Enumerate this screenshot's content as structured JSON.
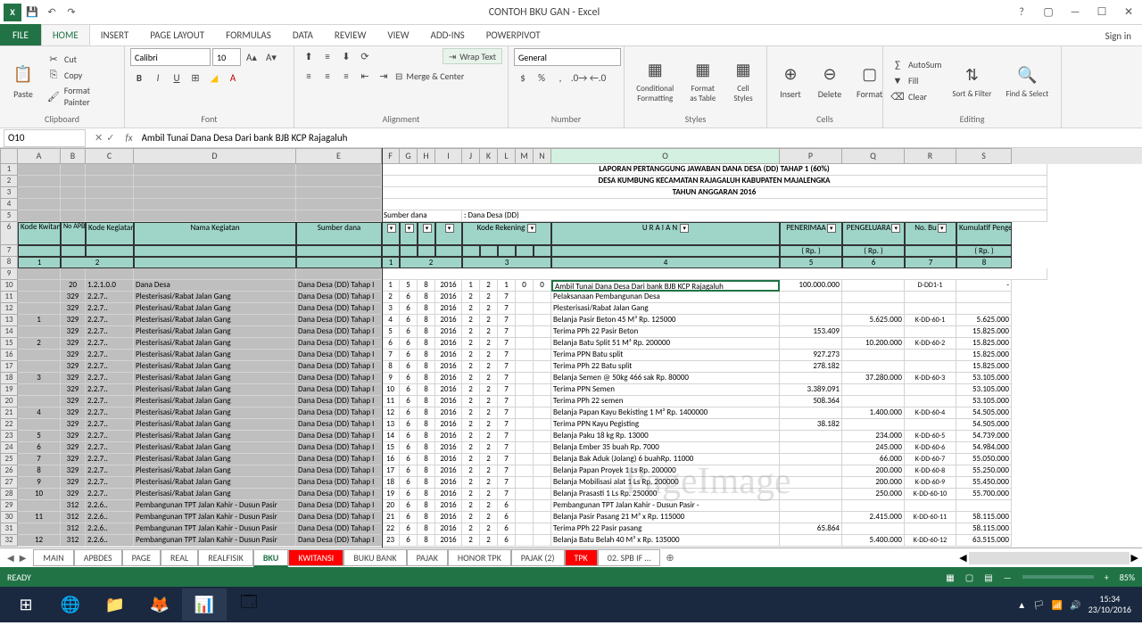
{
  "app": {
    "title": "CONTOH BKU GAN - Excel"
  },
  "ribbon_tabs": {
    "file": "FILE",
    "home": "HOME",
    "insert": "INSERT",
    "pagelayout": "PAGE LAYOUT",
    "formulas": "FORMULAS",
    "data": "DATA",
    "review": "REVIEW",
    "view": "VIEW",
    "addins": "ADD-INS",
    "powerpivot": "POWERPIVOT",
    "signin": "Sign in"
  },
  "clipboard": {
    "paste": "Paste",
    "cut": "Cut",
    "copy": "Copy",
    "fp": "Format Painter",
    "label": "Clipboard"
  },
  "font": {
    "name": "Calibri",
    "size": "10",
    "label": "Font"
  },
  "align": {
    "wt": "Wrap Text",
    "mc": "Merge & Center",
    "label": "Alignment"
  },
  "number": {
    "fmt": "General",
    "label": "Number"
  },
  "styles": {
    "cf": "Conditional Formatting",
    "fat": "Format as Table",
    "cs": "Cell Styles",
    "label": "Styles"
  },
  "cells": {
    "ins": "Insert",
    "del": "Delete",
    "fmt": "Format",
    "label": "Cells"
  },
  "editing": {
    "as": "AutoSum",
    "fill": "Fill",
    "clr": "Clear",
    "sf": "Sort & Filter",
    "fs": "Find & Select",
    "label": "Editing"
  },
  "namebox": "O10",
  "formula": "Ambil Tunai Dana Desa Dari bank BJB KCP Rajagaluh",
  "cols": [
    "A",
    "B",
    "C",
    "D",
    "E",
    "F",
    "G",
    "H",
    "I",
    "J",
    "K",
    "L",
    "M",
    "N",
    "O",
    "P",
    "Q",
    "R",
    "S"
  ],
  "rpt": {
    "t1": "LAPORAN PERTANGGUNG JAWABAN DANA DESA (DD) TAHAP 1 (60%)",
    "t2": "DESA KUMBUNG KECAMATAN RAJAGALUH KABUPATEN MAJALENGKA",
    "t3": "TAHUN ANGGARAN 2016",
    "sd_l": "Sumber dana",
    "sd_v": ": Dana Desa (DD)"
  },
  "hdr": {
    "kk": "Kode Kwitansi",
    "noap": "No APBD ES",
    "kkeg": "Kode Kegiatan",
    "nk": "Nama Kegiatan",
    "sd": "Sumber dana",
    "kr": "Kode Rekening",
    "ur": "U R A I A N",
    "pen": "PENERIMAA",
    "peng": "PENGELUARA",
    "nb": "No. Bu",
    "kp": "Kumulatif Pengeluaran",
    "rp": "( Rp. )",
    "n1": "1",
    "n2": "2",
    "n3": "3",
    "n4": "4",
    "n5": "5",
    "n6": "6",
    "n7": "7",
    "n8": "8"
  },
  "rows": [
    {
      "r": 10,
      "kk": "",
      "no": "20",
      "kkeg": "1.2.1.0.0",
      "nk": "Dana Desa",
      "sd": "Dana Desa (DD) Tahap I",
      "f": "1",
      "g": "5",
      "h": "8",
      "i": "2016",
      "j": "1",
      "k": "2",
      "l": "1",
      "m": "0",
      "n": "0",
      "ur": "Ambil Tunai Dana Desa Dari bank BJB KCP Rajagaluh",
      "pen": "100.000.000",
      "peng": "",
      "nb": "D-DD1-1",
      "kp": "-"
    },
    {
      "r": 11,
      "kk": "",
      "no": "329",
      "kkeg": "2.2.7..",
      "nk": "Plesterisasi/Rabat Jalan Gang",
      "sd": "Dana Desa (DD) Tahap I",
      "f": "2",
      "g": "6",
      "h": "8",
      "i": "2016",
      "j": "2",
      "k": "2",
      "l": "7",
      "m": "",
      "n": "",
      "ur": "Pelaksanaan Pembangunan Desa",
      "pen": "",
      "peng": "",
      "nb": "",
      "kp": ""
    },
    {
      "r": 12,
      "kk": "",
      "no": "329",
      "kkeg": "2.2.7..",
      "nk": "Plesterisasi/Rabat Jalan Gang",
      "sd": "Dana Desa (DD) Tahap I",
      "f": "3",
      "g": "6",
      "h": "8",
      "i": "2016",
      "j": "2",
      "k": "2",
      "l": "7",
      "m": "",
      "n": "",
      "ur": "Plesterisasi/Rabat Jalan Gang",
      "pen": "",
      "peng": "",
      "nb": "",
      "kp": ""
    },
    {
      "r": 13,
      "kk": "1",
      "no": "329",
      "kkeg": "2.2.7..",
      "nk": "Plesterisasi/Rabat Jalan Gang",
      "sd": "Dana Desa (DD) Tahap I",
      "f": "4",
      "g": "6",
      "h": "8",
      "i": "2016",
      "j": "2",
      "k": "2",
      "l": "7",
      "m": "",
      "n": "",
      "ur": "Belanja  Pasir Beton 45 M³ Rp. 125000",
      "pen": "",
      "peng": "5.625.000",
      "nb": "K-DD-60-1",
      "kp": "5.625.000"
    },
    {
      "r": 14,
      "kk": "",
      "no": "329",
      "kkeg": "2.2.7..",
      "nk": "Plesterisasi/Rabat Jalan Gang",
      "sd": "Dana Desa (DD) Tahap I",
      "f": "5",
      "g": "6",
      "h": "8",
      "i": "2016",
      "j": "2",
      "k": "2",
      "l": "7",
      "m": "",
      "n": "",
      "ur": "Terima PPh 22 Pasir Beton",
      "pen": "153.409",
      "peng": "",
      "nb": "",
      "kp": "15.825.000"
    },
    {
      "r": 15,
      "kk": "2",
      "no": "329",
      "kkeg": "2.2.7..",
      "nk": "Plesterisasi/Rabat Jalan Gang",
      "sd": "Dana Desa (DD) Tahap I",
      "f": "6",
      "g": "6",
      "h": "8",
      "i": "2016",
      "j": "2",
      "k": "2",
      "l": "7",
      "m": "",
      "n": "",
      "ur": "Belanja  Batu Split 51 M³ Rp. 200000",
      "pen": "",
      "peng": "10.200.000",
      "nb": "K-DD-60-2",
      "kp": "15.825.000"
    },
    {
      "r": 16,
      "kk": "",
      "no": "329",
      "kkeg": "2.2.7..",
      "nk": "Plesterisasi/Rabat Jalan Gang",
      "sd": "Dana Desa (DD) Tahap I",
      "f": "7",
      "g": "6",
      "h": "8",
      "i": "2016",
      "j": "2",
      "k": "2",
      "l": "7",
      "m": "",
      "n": "",
      "ur": "Terima PPN  Batu split",
      "pen": "927.273",
      "peng": "",
      "nb": "",
      "kp": "15.825.000"
    },
    {
      "r": 17,
      "kk": "",
      "no": "329",
      "kkeg": "2.2.7..",
      "nk": "Plesterisasi/Rabat Jalan Gang",
      "sd": "Dana Desa (DD) Tahap I",
      "f": "8",
      "g": "6",
      "h": "8",
      "i": "2016",
      "j": "2",
      "k": "2",
      "l": "7",
      "m": "",
      "n": "",
      "ur": "Terima PPh 22 Batu split",
      "pen": "278.182",
      "peng": "",
      "nb": "",
      "kp": "15.825.000"
    },
    {
      "r": 18,
      "kk": "3",
      "no": "329",
      "kkeg": "2.2.7..",
      "nk": "Plesterisasi/Rabat Jalan Gang",
      "sd": "Dana Desa (DD) Tahap I",
      "f": "9",
      "g": "6",
      "h": "8",
      "i": "2016",
      "j": "2",
      "k": "2",
      "l": "7",
      "m": "",
      "n": "",
      "ur": "Belanja  Semen @ 50kg 466 sak Rp. 80000",
      "pen": "",
      "peng": "37.280.000",
      "nb": "K-DD-60-3",
      "kp": "53.105.000"
    },
    {
      "r": 19,
      "kk": "",
      "no": "329",
      "kkeg": "2.2.7..",
      "nk": "Plesterisasi/Rabat Jalan Gang",
      "sd": "Dana Desa (DD) Tahap I",
      "f": "10",
      "g": "6",
      "h": "8",
      "i": "2016",
      "j": "2",
      "k": "2",
      "l": "7",
      "m": "",
      "n": "",
      "ur": "Terima PPN  Semen",
      "pen": "3.389.091",
      "peng": "",
      "nb": "",
      "kp": "53.105.000"
    },
    {
      "r": 20,
      "kk": "",
      "no": "329",
      "kkeg": "2.2.7..",
      "nk": "Plesterisasi/Rabat Jalan Gang",
      "sd": "Dana Desa (DD) Tahap I",
      "f": "11",
      "g": "6",
      "h": "8",
      "i": "2016",
      "j": "2",
      "k": "2",
      "l": "7",
      "m": "",
      "n": "",
      "ur": "Terima PPh 22 semen",
      "pen": "508.364",
      "peng": "",
      "nb": "",
      "kp": "53.105.000"
    },
    {
      "r": 21,
      "kk": "4",
      "no": "329",
      "kkeg": "2.2.7..",
      "nk": "Plesterisasi/Rabat Jalan Gang",
      "sd": "Dana Desa (DD) Tahap I",
      "f": "12",
      "g": "6",
      "h": "8",
      "i": "2016",
      "j": "2",
      "k": "2",
      "l": "7",
      "m": "",
      "n": "",
      "ur": "Belanja  Papan Kayu Bekisting 1 M³ Rp. 1400000",
      "pen": "",
      "peng": "1.400.000",
      "nb": "K-DD-60-4",
      "kp": "54.505.000"
    },
    {
      "r": 22,
      "kk": "",
      "no": "329",
      "kkeg": "2.2.7..",
      "nk": "Plesterisasi/Rabat Jalan Gang",
      "sd": "Dana Desa (DD) Tahap I",
      "f": "13",
      "g": "6",
      "h": "8",
      "i": "2016",
      "j": "2",
      "k": "2",
      "l": "7",
      "m": "",
      "n": "",
      "ur": "Terima PPN  Kayu Pegisting",
      "pen": "38.182",
      "peng": "",
      "nb": "",
      "kp": "54.505.000"
    },
    {
      "r": 23,
      "kk": "5",
      "no": "329",
      "kkeg": "2.2.7..",
      "nk": "Plesterisasi/Rabat Jalan Gang",
      "sd": "Dana Desa (DD) Tahap I",
      "f": "14",
      "g": "6",
      "h": "8",
      "i": "2016",
      "j": "2",
      "k": "2",
      "l": "7",
      "m": "",
      "n": "",
      "ur": "Belanja  Paku 18 kg Rp. 13000",
      "pen": "",
      "peng": "234.000",
      "nb": "K-DD-60-5",
      "kp": "54.739.000"
    },
    {
      "r": 24,
      "kk": "6",
      "no": "329",
      "kkeg": "2.2.7..",
      "nk": "Plesterisasi/Rabat Jalan Gang",
      "sd": "Dana Desa (DD) Tahap I",
      "f": "15",
      "g": "6",
      "h": "8",
      "i": "2016",
      "j": "2",
      "k": "2",
      "l": "7",
      "m": "",
      "n": "",
      "ur": "Belanja  Ember 35 buah Rp. 7000",
      "pen": "",
      "peng": "245.000",
      "nb": "K-DD-60-6",
      "kp": "54.984.000"
    },
    {
      "r": 25,
      "kk": "7",
      "no": "329",
      "kkeg": "2.2.7..",
      "nk": "Plesterisasi/Rabat Jalan Gang",
      "sd": "Dana Desa (DD) Tahap I",
      "f": "16",
      "g": "6",
      "h": "8",
      "i": "2016",
      "j": "2",
      "k": "2",
      "l": "7",
      "m": "",
      "n": "",
      "ur": "Belanja  Bak Aduk (Jolang) 6 buahRp. 11000",
      "pen": "",
      "peng": "66.000",
      "nb": "K-DD-60-7",
      "kp": "55.050.000"
    },
    {
      "r": 26,
      "kk": "8",
      "no": "329",
      "kkeg": "2.2.7..",
      "nk": "Plesterisasi/Rabat Jalan Gang",
      "sd": "Dana Desa (DD) Tahap I",
      "f": "17",
      "g": "6",
      "h": "8",
      "i": "2016",
      "j": "2",
      "k": "2",
      "l": "7",
      "m": "",
      "n": "",
      "ur": "Belanja  Papan Proyek 1 Ls Rp. 200000",
      "pen": "",
      "peng": "200.000",
      "nb": "K-DD-60-8",
      "kp": "55.250.000"
    },
    {
      "r": 27,
      "kk": "9",
      "no": "329",
      "kkeg": "2.2.7..",
      "nk": "Plesterisasi/Rabat Jalan Gang",
      "sd": "Dana Desa (DD) Tahap I",
      "f": "18",
      "g": "6",
      "h": "8",
      "i": "2016",
      "j": "2",
      "k": "2",
      "l": "7",
      "m": "",
      "n": "",
      "ur": "Belanja  Mobilisasi alat 1 Ls Rp. 200000",
      "pen": "",
      "peng": "200.000",
      "nb": "K-DD-60-9",
      "kp": "55.450.000"
    },
    {
      "r": 28,
      "kk": "10",
      "no": "329",
      "kkeg": "2.2.7..",
      "nk": "Plesterisasi/Rabat Jalan Gang",
      "sd": "Dana Desa (DD) Tahap I",
      "f": "19",
      "g": "6",
      "h": "8",
      "i": "2016",
      "j": "2",
      "k": "2",
      "l": "7",
      "m": "",
      "n": "",
      "ur": "Belanja  Prasasti 1 Ls Rp. 250000",
      "pen": "",
      "peng": "250.000",
      "nb": "K-DD-60-10",
      "kp": "55.700.000"
    },
    {
      "r": 29,
      "kk": "",
      "no": "312",
      "kkeg": "2.2.6..",
      "nk": "Pembangunan TPT Jalan Kahir - Dusun Pasir",
      "sd": "Dana Desa (DD) Tahap I",
      "f": "20",
      "g": "6",
      "h": "8",
      "i": "2016",
      "j": "2",
      "k": "2",
      "l": "6",
      "m": "",
      "n": "",
      "ur": "Pembangunan TPT Jalan Kahir - Dusun Pasir   -",
      "pen": "",
      "peng": "",
      "nb": "",
      "kp": ""
    },
    {
      "r": 30,
      "kk": "11",
      "no": "312",
      "kkeg": "2.2.6..",
      "nk": "Pembangunan TPT Jalan Kahir - Dusun Pasir",
      "sd": "Dana Desa (DD) Tahap I",
      "f": "21",
      "g": "6",
      "h": "8",
      "i": "2016",
      "j": "2",
      "k": "2",
      "l": "6",
      "m": "",
      "n": "",
      "ur": "Belanja  Pasir Pasang 21 M³ x Rp. 115000",
      "pen": "",
      "peng": "2.415.000",
      "nb": "K-DD-60-11",
      "kp": "58.115.000"
    },
    {
      "r": 31,
      "kk": "",
      "no": "312",
      "kkeg": "2.2.6..",
      "nk": "Pembangunan TPT Jalan Kahir - Dusun Pasir",
      "sd": "Dana Desa (DD) Tahap I",
      "f": "22",
      "g": "6",
      "h": "8",
      "i": "2016",
      "j": "2",
      "k": "2",
      "l": "6",
      "m": "",
      "n": "",
      "ur": "Terima PPh 22 Pasir pasang",
      "pen": "65.864",
      "peng": "",
      "nb": "",
      "kp": "58.115.000"
    },
    {
      "r": 32,
      "kk": "12",
      "no": "312",
      "kkeg": "2.2.6..",
      "nk": "Pembangunan TPT Jalan Kahir - Dusun Pasir",
      "sd": "Dana Desa (DD) Tahap I",
      "f": "23",
      "g": "6",
      "h": "8",
      "i": "2016",
      "j": "2",
      "k": "2",
      "l": "6",
      "m": "",
      "n": "",
      "ur": "Belanja  Batu Belah 40 M³ x Rp. 135000",
      "pen": "",
      "peng": "5.400.000",
      "nb": "K-DD-60-12",
      "kp": "63.515.000"
    }
  ],
  "sheets": {
    "main": "MAIN",
    "apbdes": "APBDES",
    "page": "PAGE",
    "real": "REAL",
    "realfisik": "REALFISIK",
    "bku": "BKU",
    "kwitansi": "KWITANSI",
    "bukubank": "BUKU BANK",
    "pajak": "PAJAK",
    "honortpk": "HONOR TPK",
    "pajak2": "PAJAK (2)",
    "tpk": "TPK",
    "spb": "02. SPB IF …"
  },
  "status": {
    "ready": "READY",
    "zoom": "85%"
  },
  "taskbar": {
    "time": "15:34",
    "date": "23/10/2016"
  }
}
